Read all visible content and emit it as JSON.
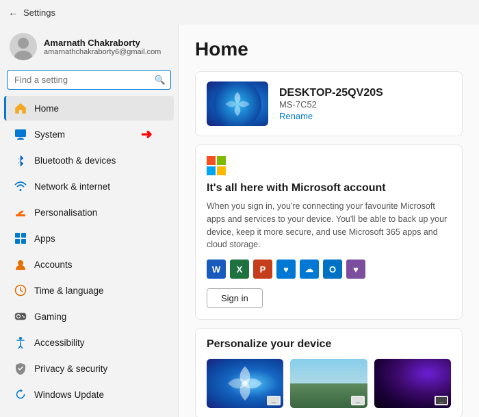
{
  "titleBar": {
    "backLabel": "←",
    "title": "Settings"
  },
  "sidebar": {
    "searchPlaceholder": "Find a setting",
    "user": {
      "name": "Amarnath Chakraborty",
      "email": "amarnathchakraborty6@gmail.com"
    },
    "navItems": [
      {
        "id": "home",
        "label": "Home",
        "icon": "🏠",
        "active": true
      },
      {
        "id": "system",
        "label": "System",
        "icon": "🖥️",
        "active": false,
        "hasArrow": true
      },
      {
        "id": "bluetooth",
        "label": "Bluetooth & devices",
        "icon": "bluetooth",
        "active": false
      },
      {
        "id": "network",
        "label": "Network & internet",
        "icon": "wifi",
        "active": false
      },
      {
        "id": "personalisation",
        "label": "Personalisation",
        "icon": "brush",
        "active": false
      },
      {
        "id": "apps",
        "label": "Apps",
        "icon": "apps",
        "active": false
      },
      {
        "id": "accounts",
        "label": "Accounts",
        "icon": "person",
        "active": false
      },
      {
        "id": "time",
        "label": "Time & language",
        "icon": "time",
        "active": false
      },
      {
        "id": "gaming",
        "label": "Gaming",
        "icon": "gaming",
        "active": false
      },
      {
        "id": "accessibility",
        "label": "Accessibility",
        "icon": "access",
        "active": false
      },
      {
        "id": "privacy",
        "label": "Privacy & security",
        "icon": "shield",
        "active": false
      },
      {
        "id": "update",
        "label": "Windows Update",
        "icon": "update",
        "active": false
      }
    ]
  },
  "content": {
    "pageTitle": "Home",
    "device": {
      "name": "DESKTOP-25QV20S",
      "model": "MS-7C52",
      "renameLabel": "Rename"
    },
    "microsoftCard": {
      "title": "It's all here with Microsoft account",
      "description": "When you sign in, you're connecting your favourite Microsoft apps and services to your device. You'll be able to back up your device, keep it more secure, and use Microsoft 365 apps and cloud storage.",
      "signInLabel": "Sign in"
    },
    "personalizeCard": {
      "title": "Personalize your device"
    }
  }
}
